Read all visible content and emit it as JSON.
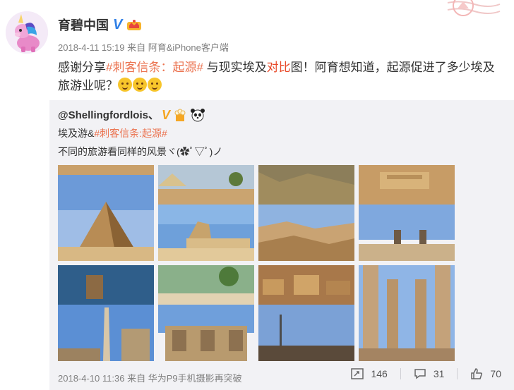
{
  "post": {
    "author": "育碧中国",
    "meta_time": "2018-4-11 15:19",
    "meta_from": "来自",
    "meta_source": "阿育&iPhone客户端",
    "text_before": "感谢分享",
    "topic": "#刺客信条：起源#",
    "text_mid": " 与现实埃及",
    "highlight": "对比",
    "text_after": "图！阿育想知道，起源促进了多少埃及旅游业呢？"
  },
  "repost": {
    "user": "@Shellingfordlois、",
    "line1_prefix": "埃及游&",
    "line1_topic": "#刺客信条:起源#",
    "line2": "不同的旅游看同样的风景ヾ(✿ﾟ▽ﾟ)ノ",
    "footer_time": "2018-4-10 11:36",
    "footer_from": "来自",
    "footer_source": "华为P9手机摄影再突破",
    "repost_count": "146",
    "comment_count": "31",
    "like_count": "70"
  },
  "colors": {
    "topic": "#eb7350",
    "verified": "#2f7fe6",
    "panel": "#f2f2f5"
  },
  "icons": [
    "verified-v-icon",
    "crown-badge-icon",
    "repost-icon",
    "comment-icon",
    "like-icon"
  ]
}
